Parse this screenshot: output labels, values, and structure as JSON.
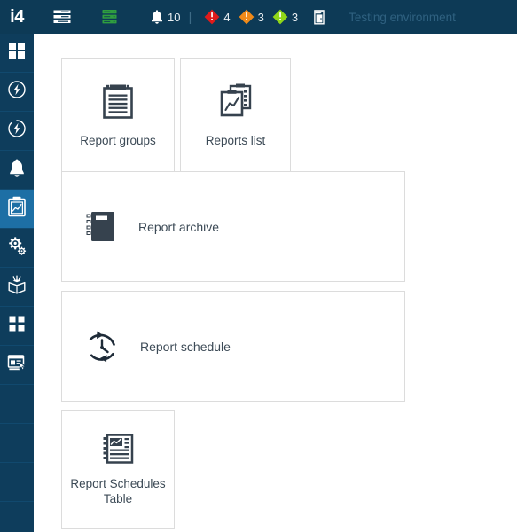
{
  "topbar": {
    "logo": "i4",
    "icons": [
      {
        "name": "form-list-icon",
        "title": "Forms"
      },
      {
        "name": "server-database-icon",
        "title": "Servers"
      }
    ],
    "notifications": {
      "icon": "bell-icon",
      "count": "10"
    },
    "separator": "|",
    "alarms": [
      {
        "name": "alarm-critical",
        "count": "4",
        "color": "#e01b1b"
      },
      {
        "name": "alarm-high",
        "count": "3",
        "color": "#f08a19"
      },
      {
        "name": "alarm-medium",
        "count": "3",
        "color": "#8fd618"
      }
    ],
    "logout": {
      "name": "logout-door-icon"
    },
    "environment_label": "Testing environment"
  },
  "sidebar": {
    "expand_button": {
      "name": "expand-sidebar-button",
      "glyph": "›"
    },
    "items": [
      {
        "name": "sidebar-item-dashboard",
        "icon": "grid-icon",
        "active": false
      },
      {
        "name": "sidebar-item-energy",
        "icon": "bolt-circle-icon",
        "active": false
      },
      {
        "name": "sidebar-item-energy-alt",
        "icon": "bolt-circle-alt-icon",
        "active": false
      },
      {
        "name": "sidebar-item-alarms",
        "icon": "bell-icon",
        "active": false
      },
      {
        "name": "sidebar-item-reports",
        "icon": "clipboard-chart-icon",
        "active": true
      },
      {
        "name": "sidebar-item-settings",
        "icon": "gears-icon",
        "active": false
      },
      {
        "name": "sidebar-item-assets",
        "icon": "open-box-icon",
        "active": false
      },
      {
        "name": "sidebar-item-apps",
        "icon": "grid-icon",
        "active": false
      },
      {
        "name": "sidebar-item-screens",
        "icon": "window-cursor-icon",
        "active": false
      },
      {
        "name": "sidebar-item-blank-1",
        "icon": "",
        "active": false
      },
      {
        "name": "sidebar-item-blank-2",
        "icon": "",
        "active": false
      },
      {
        "name": "sidebar-item-blank-3",
        "icon": "",
        "active": false
      }
    ]
  },
  "main": {
    "tiles": [
      {
        "id": "report-groups",
        "label": "Report groups",
        "icon": "clipboard-lines-icon",
        "layout": "vertical"
      },
      {
        "id": "reports-list",
        "label": "Reports list",
        "icon": "clipboards-chart-icon",
        "layout": "vertical"
      },
      {
        "id": "report-archive",
        "label": "Report archive",
        "icon": "notebook-icon",
        "layout": "horizontal"
      },
      {
        "id": "report-schedule",
        "label": "Report schedule",
        "icon": "clock-refresh-icon",
        "layout": "horizontal"
      },
      {
        "id": "report-sched-tb",
        "label": "Report Schedules Table",
        "icon": "report-table-icon",
        "layout": "vertical"
      }
    ]
  },
  "colors": {
    "topbar_bg": "#0d3a56",
    "sidebar_bg": "#0e3d5c",
    "sidebar_active": "#1d6fa5",
    "tile_border": "#dcdcdc",
    "text_dark": "#3c4a56",
    "env_text": "#2f6180"
  }
}
